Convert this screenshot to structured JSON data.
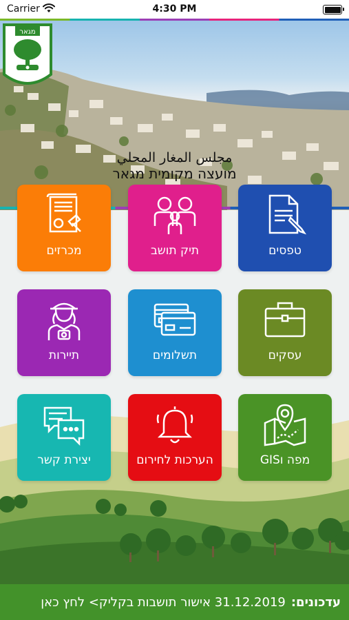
{
  "status_bar": {
    "carrier": "Carrier",
    "time": "4:30 PM"
  },
  "header": {
    "title_ar": "مجلس المغار المحلي",
    "title_he": "מועצה מקומית מגאר",
    "logo_text": "מגאר"
  },
  "tiles": [
    {
      "label": "טפסים",
      "icon": "document-pen-icon",
      "color": "#1f4fb0"
    },
    {
      "label": "תיק תושב",
      "icon": "family-icon",
      "color": "#e01f8c"
    },
    {
      "label": "מכרזים",
      "icon": "contract-gavel-icon",
      "color": "#fb7d07"
    },
    {
      "label": "עסקים",
      "icon": "briefcase-icon",
      "color": "#6b8a24"
    },
    {
      "label": "תשלומים",
      "icon": "credit-cards-icon",
      "color": "#1e8fd0"
    },
    {
      "label": "תיירות",
      "icon": "tourist-icon",
      "color": "#9b28b3"
    },
    {
      "label": "מפה וGIS",
      "icon": "map-pin-icon",
      "color": "#4a9326"
    },
    {
      "label": "הערכות לחירום",
      "icon": "bell-icon",
      "color": "#e50d13"
    },
    {
      "label": "יצירת קשר",
      "icon": "chat-icon",
      "color": "#17b7b1"
    }
  ],
  "ticker": {
    "heading": "עדכונים:",
    "text": "31.12.2019 אישור תושבות בקליק> לחץ כאן"
  }
}
